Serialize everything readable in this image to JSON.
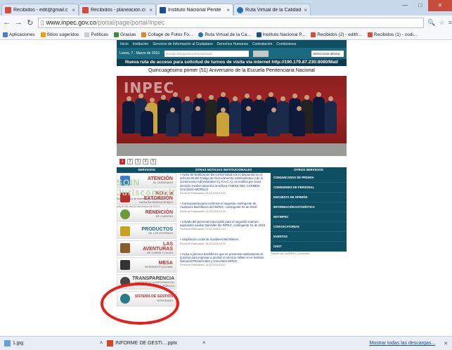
{
  "browser": {
    "tabs": [
      {
        "label": "Recibidos - edit@gmail.c",
        "icon": "gmail-icon",
        "color": "#d64b3a"
      },
      {
        "label": "Recibidos - planeacion.ci",
        "icon": "gmail-icon",
        "color": "#d64b3a"
      },
      {
        "label": "Instituto Nacional Penite",
        "icon": "inpec-icon",
        "color": "#1c4f8a",
        "active": true
      },
      {
        "label": "Ruta Virtual de la Calidad",
        "icon": "globe-icon",
        "color": "#2b6fb5"
      }
    ],
    "url_prefix": "www.inpec.gov.co",
    "url_path": "/portal/page/portal/Inpec",
    "bookmarks": [
      {
        "label": "Aplicaciones",
        "color": "#4a7bd0"
      },
      {
        "label": "Sitios sugeridos",
        "color": "#f0a400"
      },
      {
        "label": "Políticas",
        "color": "#cccccc"
      },
      {
        "label": "Gracias",
        "color": "#3c8c3c"
      },
      {
        "label": "Collage de Fotos Fo...",
        "color": "#e08a1e"
      },
      {
        "label": "Ruta Virtual de la Ca...",
        "color": "#2b6fb5"
      },
      {
        "label": "Instituto Nacional P...",
        "color": "#1c4f8a"
      },
      {
        "label": "Recibidos (2) - edith...",
        "color": "#d64b3a"
      },
      {
        "label": "Recibidos (1) - codi...",
        "color": "#d64b3a"
      }
    ]
  },
  "site": {
    "nav": [
      "Inicio",
      "Institución",
      "Servicios de Información al Ciudadano",
      "Derechos Humanos",
      "Contratación",
      "Contáctenos"
    ],
    "date": "Lunes, 7 - Marzo de 2016",
    "search_placeholder": "Google  Búsqueda personalizada",
    "select_label": "Seleccionar idioma",
    "banner": "Nueva ruta de acceso para solicitud de turnos de visita via internet http://190.179.87.230:8080/Mat/",
    "headline": "Quincuagésimo primer (51) Aniversario de la Escuela Penitenciaria Nacional",
    "photo_caption": "INPEC",
    "pages": [
      "1",
      "2",
      "3",
      "4",
      "5"
    ],
    "col_services": "SERVICIOS",
    "col_news": "OTRAS NOTICIAS INSTITUCIONALES",
    "col_other": "OTROS SERVICIOS",
    "services": [
      {
        "big": "ATENCIÓN",
        "small": "al ciudadano",
        "color": "#3d7cc9"
      },
      {
        "big": "NO a la EXTORSIÓN",
        "small": "haga su denuncia aquí",
        "color": "#c42b2b"
      },
      {
        "big": "RENDICIÓN",
        "small": "de cuentas",
        "color": "#6a9a3a"
      },
      {
        "big": "PRODUCTOS",
        "small": "de los internos",
        "color": "#c7a21e"
      },
      {
        "big": "LAS AVENTURAS",
        "small": "de Chispa y Lucas",
        "color": "#8a5a2a"
      },
      {
        "big": "MESA",
        "small": "interinstitucional",
        "color": "#333333"
      },
      {
        "big": "TRANSPARENCIA",
        "small": "y acceso a la información pública",
        "color": "#444444"
      },
      {
        "big": "SISTEMA DE GESTIÓN",
        "small": "integrado",
        "color": "#2a7a8a"
      }
    ],
    "news": [
      {
        "title": "Aviso de Notificación De conformidad con lo dispuesto en el artículo 69 del Código de Procedimiento Administrativo y de lo Contencioso Administrativo (C.P.A.C.A), se notifica por aviso decisión medico laboral a la señora YAMILE DEL CARMEN SALCEDO MORELO",
        "date": "Fecha de Publicación: 04-03-2016 15:30"
      },
      {
        "title": "Convocatoria para confirmar el segundo contingente de Auxiliares Bachilleres del INPEC, contingente 02 de 2016",
        "date": "Fecha de Publicación: 01-03-2016 12:23"
      },
      {
        "title": "Listado del personal convocado para el segundo examen, aspirantes Auxiliar Bachiller del INPEC, contingente 01 de 2016",
        "date": "Fecha de Publicación: 01-03-2016 12:23"
      },
      {
        "title": "Ampliación cuota de Auxiliares Bachilleres",
        "date": "Fecha de Publicación: 26-02-2016 16:30"
      },
      {
        "title": "Aviso a jóvenes bachilleres que se presentan adelantando el proceso para ingresar a prestar el servicio militar en el Instituto Nacional Penitenciario y Carcelario INPEC",
        "date": "Fecha de Publicación: 16-02-2016 16:10"
      }
    ],
    "other_services": [
      "COMUNICADOS DE PRENSA",
      "COMISIONES DE PERSONAL",
      "ENCUESTA DE OPINIÓN",
      "INFORMACIÓN ESTADÍSTICA",
      "NOTINPEC",
      "CONVOCATORIAS",
      "EVENTOS",
      "CHAT"
    ],
    "tweets": "Tweets por @INPEC_colombia",
    "soin_logo": "SOIN",
    "soin_sub": "Jurisconsult",
    "soin_desc": "Sistema Único de Información Normativo",
    "ley": "Ley 1709 del 20 de enero de 2014"
  },
  "downloads": [
    {
      "label": "1.jpg",
      "color": "#6aa0d8"
    },
    {
      "label": "INFORME DE GESTI....pptx",
      "color": "#d24726"
    }
  ],
  "show_all": "Mostrar todas las descargas..."
}
